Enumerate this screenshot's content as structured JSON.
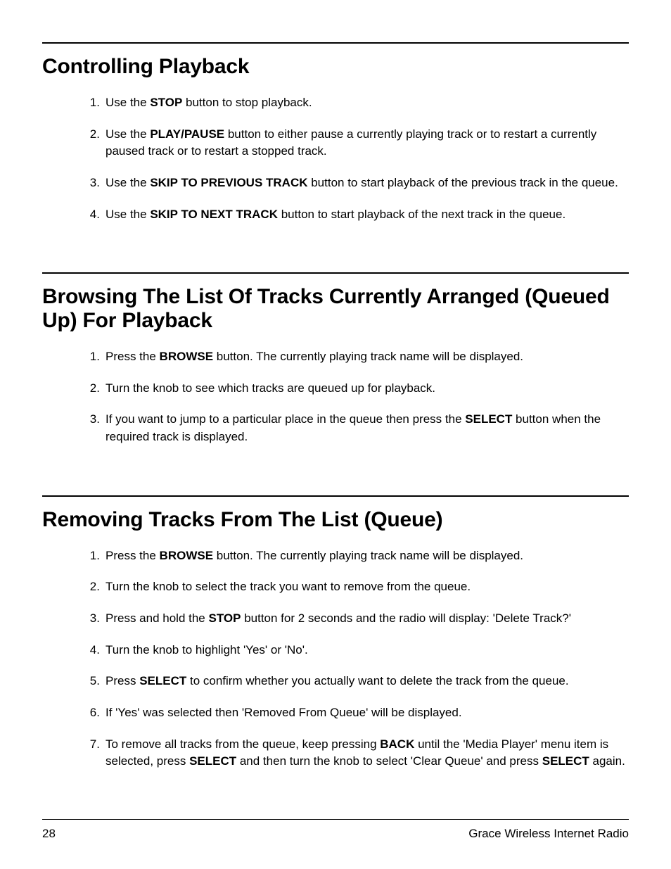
{
  "sections": [
    {
      "heading": "Controlling Playback",
      "items": [
        [
          {
            "t": "Use the "
          },
          {
            "t": "STOP",
            "b": true
          },
          {
            "t": " button to stop playback."
          }
        ],
        [
          {
            "t": "Use the "
          },
          {
            "t": "PLAY/PAUSE",
            "b": true
          },
          {
            "t": " button to either pause a currently playing track or to restart a currently paused track or to restart a stopped track."
          }
        ],
        [
          {
            "t": "Use the "
          },
          {
            "t": "SKIP TO PREVIOUS TRACK",
            "b": true
          },
          {
            "t": " button to start playback of the previous track in the queue."
          }
        ],
        [
          {
            "t": "Use the "
          },
          {
            "t": "SKIP TO NEXT TRACK",
            "b": true
          },
          {
            "t": " button to start playback of the next track in the queue."
          }
        ]
      ]
    },
    {
      "heading": "Browsing The List Of Tracks Currently Arranged (Queued Up)  For Playback",
      "items": [
        [
          {
            "t": "Press the "
          },
          {
            "t": "BROWSE",
            "b": true
          },
          {
            "t": " button. The currently playing track name will be displayed."
          }
        ],
        [
          {
            "t": "Turn the knob to see which tracks are queued up for playback."
          }
        ],
        [
          {
            "t": "If you want to jump to a particular place in the queue then press the "
          },
          {
            "t": "SELECT",
            "b": true
          },
          {
            "t": " button when the required track is displayed."
          }
        ]
      ]
    },
    {
      "heading": "Removing Tracks From The List (Queue)",
      "items": [
        [
          {
            "t": "Press the "
          },
          {
            "t": "BROWSE",
            "b": true
          },
          {
            "t": " button. The currently playing track name will be displayed."
          }
        ],
        [
          {
            "t": "Turn the knob to select the track you want to remove from the queue."
          }
        ],
        [
          {
            "t": "Press and hold the "
          },
          {
            "t": "STOP",
            "b": true
          },
          {
            "t": " button for 2 seconds and the radio will display: 'Delete Track?'"
          }
        ],
        [
          {
            "t": "Turn the knob to highlight 'Yes' or 'No'."
          }
        ],
        [
          {
            "t": "Press "
          },
          {
            "t": "SELECT",
            "b": true
          },
          {
            "t": " to confirm whether you actually want to delete the track from the queue."
          }
        ],
        [
          {
            "t": "If 'Yes' was selected then 'Removed From Queue' will be displayed."
          }
        ],
        [
          {
            "t": "To remove all tracks from the queue, keep pressing "
          },
          {
            "t": "BACK",
            "b": true
          },
          {
            "t": " until the 'Media Player' menu item is selected, press "
          },
          {
            "t": "SELECT",
            "b": true
          },
          {
            "t": " and then turn the knob to select 'Clear Queue' and press "
          },
          {
            "t": "SELECT",
            "b": true
          },
          {
            "t": " again."
          }
        ]
      ]
    }
  ],
  "footer": {
    "page_number": "28",
    "product": "Grace Wireless Internet Radio"
  }
}
